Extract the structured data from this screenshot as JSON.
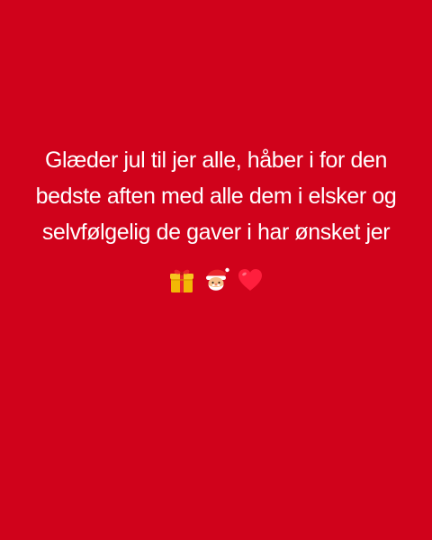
{
  "story": {
    "background_color": "#d0021b",
    "text_color": "#ffffff",
    "message_lines": [
      "Glæder jul til jer alle, håber i for den",
      "bedste aften med alle dem i elsker og",
      "selvfølgelig de gaver i har ønsket jer"
    ],
    "emojis": [
      "gift-emoji-icon",
      "santa-emoji-icon",
      "red-heart-emoji-icon"
    ]
  }
}
